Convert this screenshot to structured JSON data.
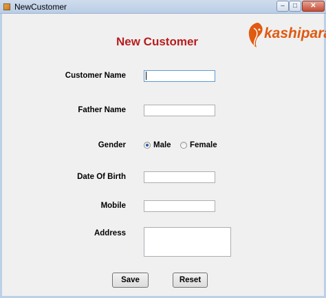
{
  "window": {
    "title": "NewCustomer",
    "minimize": "–",
    "maximize": "□",
    "close": "✕"
  },
  "form": {
    "heading": "New Customer",
    "logo_text": "kashipara",
    "labels": {
      "customer_name": "Customer Name",
      "father_name": "Father Name",
      "gender": "Gender",
      "date_of_birth": "Date Of Birth",
      "mobile": "Mobile",
      "address": "Address"
    },
    "values": {
      "customer_name": "",
      "father_name": "",
      "date_of_birth": "",
      "mobile": "",
      "address": ""
    },
    "gender_options": {
      "male": "Male",
      "female": "Female",
      "selected": "Male"
    },
    "buttons": {
      "save": "Save",
      "reset": "Reset"
    }
  },
  "colors": {
    "heading": "#b81c1c",
    "logo": "#e05a10",
    "radio_dot": "#2a5aa8"
  }
}
